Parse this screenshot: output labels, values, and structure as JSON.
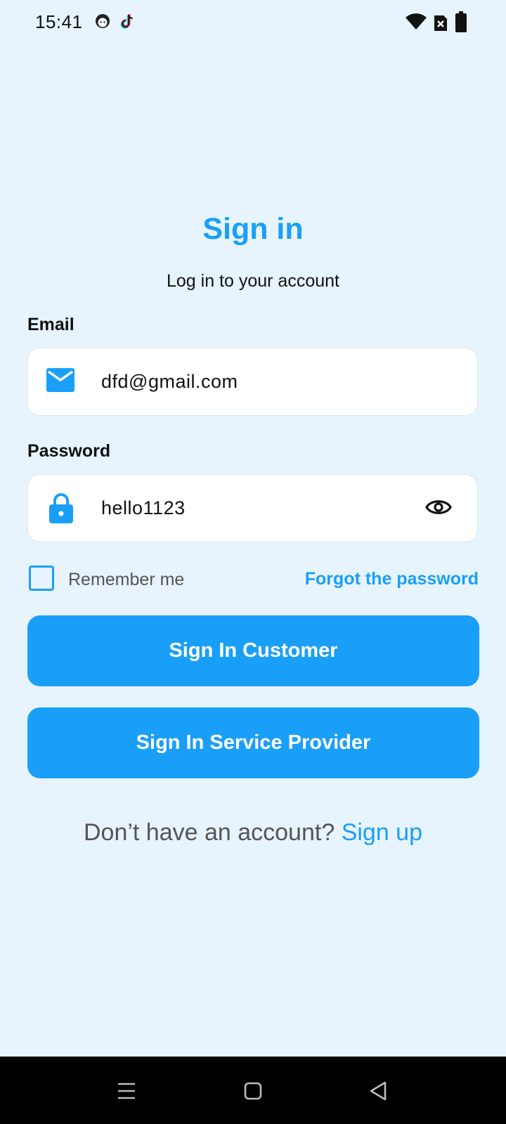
{
  "status_bar": {
    "time": "15:41",
    "icons": [
      "face-app-icon",
      "tiktok-icon",
      "wifi-icon",
      "no-sim-icon",
      "battery-icon"
    ]
  },
  "header": {
    "title": "Sign in",
    "subtitle": "Log in to your account"
  },
  "email": {
    "label": "Email",
    "value": "dfd@gmail.com",
    "icon": "mail-icon"
  },
  "password": {
    "label": "Password",
    "value": "hello1123",
    "icon": "lock-icon",
    "toggle_icon": "eye-icon"
  },
  "options": {
    "remember_label": "Remember me",
    "remember_checked": false,
    "forgot_label": "Forgot the password"
  },
  "buttons": {
    "customer_label": "Sign In Customer",
    "provider_label": "Sign In Service Provider"
  },
  "signup": {
    "prompt": "Don’t have an account? ",
    "link_label": "Sign up"
  },
  "nav_bar": {
    "icons": [
      "menu-icon",
      "home-icon",
      "back-icon"
    ]
  },
  "colors": {
    "accent": "#1a9ff8",
    "background": "#e7f4fd",
    "nav_background": "#000000"
  }
}
